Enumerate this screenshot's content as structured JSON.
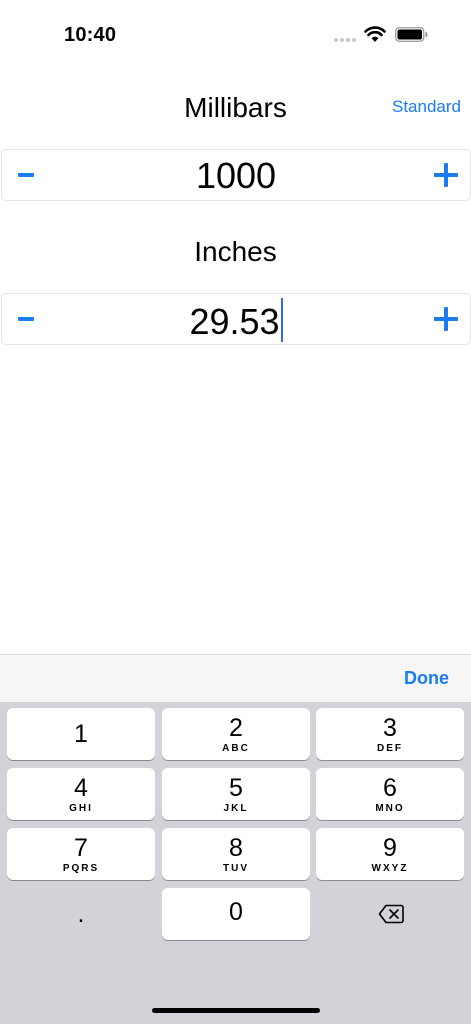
{
  "status_bar": {
    "time": "10:40"
  },
  "header": {
    "standard_label": "Standard"
  },
  "millibars": {
    "label": "Millibars",
    "value": "1000"
  },
  "inches": {
    "label": "Inches",
    "value": "29.53"
  },
  "accessory": {
    "done_label": "Done"
  },
  "keypad": {
    "keys": [
      {
        "digit": "1",
        "letters": ""
      },
      {
        "digit": "2",
        "letters": "ABC"
      },
      {
        "digit": "3",
        "letters": "DEF"
      },
      {
        "digit": "4",
        "letters": "GHI"
      },
      {
        "digit": "5",
        "letters": "JKL"
      },
      {
        "digit": "6",
        "letters": "MNO"
      },
      {
        "digit": "7",
        "letters": "PQRS"
      },
      {
        "digit": "8",
        "letters": "TUV"
      },
      {
        "digit": "9",
        "letters": "WXYZ"
      },
      {
        "digit": ".",
        "letters": ""
      },
      {
        "digit": "0",
        "letters": ""
      }
    ],
    "backspace_icon": "delete-left-icon"
  },
  "colors": {
    "accent": "#1a7cf0",
    "keyboard_bg": "#d1d3d9",
    "key_bg": "#ffffff"
  }
}
